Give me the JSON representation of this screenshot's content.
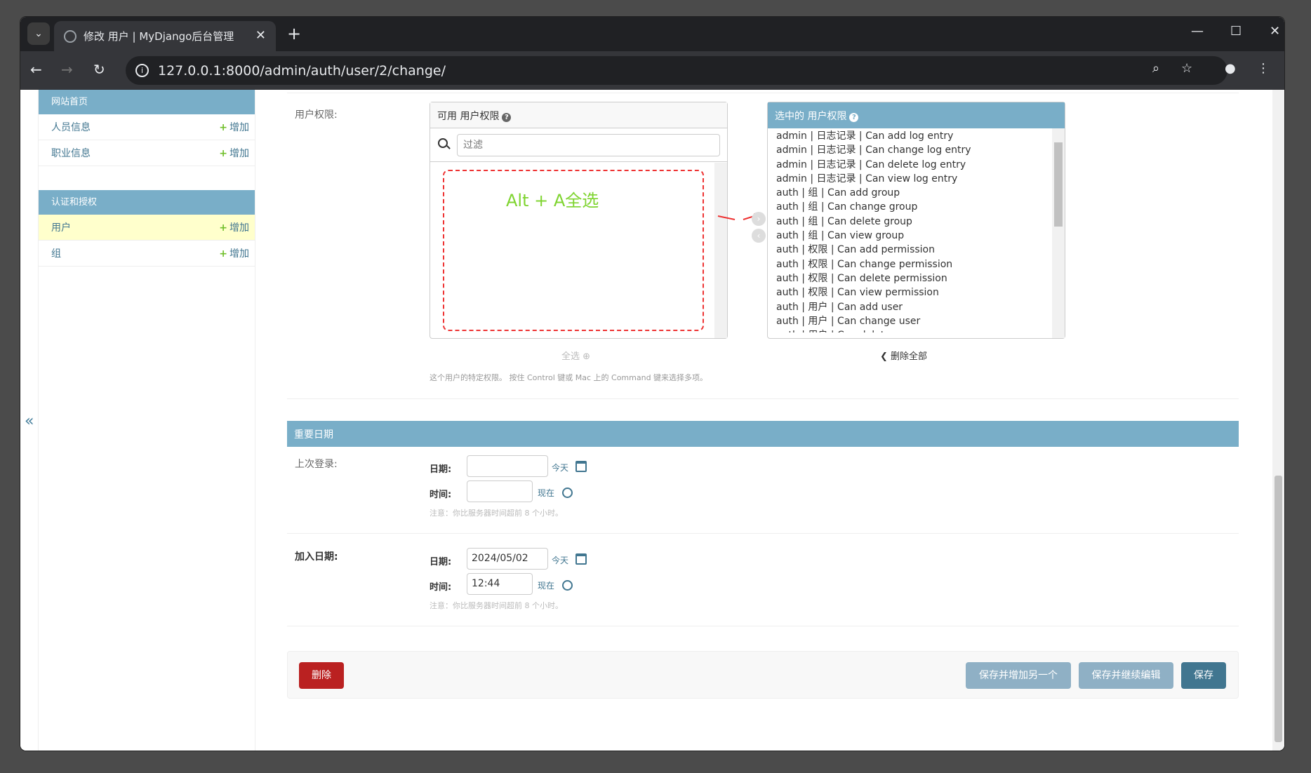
{
  "browser": {
    "tab_title": "修改 用户 | MyDjango后台管理",
    "url": "127.0.0.1:8000/admin/auth/user/2/change/"
  },
  "sidebar": {
    "modules": [
      {
        "title": "网站首页",
        "items": [
          {
            "label": "人员信息",
            "add": "增加"
          },
          {
            "label": "职业信息",
            "add": "增加"
          }
        ]
      },
      {
        "title": "认证和授权",
        "items": [
          {
            "label": "用户",
            "add": "增加"
          },
          {
            "label": "组",
            "add": "增加"
          }
        ]
      }
    ],
    "collapse": "«"
  },
  "permissions": {
    "label": "用户权限:",
    "available_title": "可用 用户权限",
    "filter_placeholder": "过滤",
    "annotation": "Alt + A全选",
    "choose_all": "全选",
    "chosen_title": "选中的 用户权限",
    "remove_all": "删除全部",
    "help_text": "这个用户的特定权限。 按住 Control 键或 Mac 上的 Command 键来选择多项。",
    "chosen_options": [
      "admin | 日志记录 | Can add log entry",
      "admin | 日志记录 | Can change log entry",
      "admin | 日志记录 | Can delete log entry",
      "admin | 日志记录 | Can view log entry",
      "auth | 组 | Can add group",
      "auth | 组 | Can change group",
      "auth | 组 | Can delete group",
      "auth | 组 | Can view group",
      "auth | 权限 | Can add permission",
      "auth | 权限 | Can change permission",
      "auth | 权限 | Can delete permission",
      "auth | 权限 | Can view permission",
      "auth | 用户 | Can add user",
      "auth | 用户 | Can change user",
      "auth | 用户 | Can delete user"
    ]
  },
  "dates": {
    "section_title": "重要日期",
    "last_login": {
      "label": "上次登录:",
      "date_label": "日期:",
      "date_value": "",
      "today": "今天",
      "time_label": "时间:",
      "time_value": "",
      "now": "现在",
      "note": "注意：你比服务器时间超前 8 个小时。"
    },
    "date_joined": {
      "label": "加入日期:",
      "date_label": "日期:",
      "date_value": "2024/05/02",
      "today": "今天",
      "time_label": "时间:",
      "time_value": "12:44",
      "now": "现在",
      "note": "注意：你比服务器时间超前 8 个小时。"
    }
  },
  "actions": {
    "delete": "删除",
    "save_add_another": "保存并增加另一个",
    "save_continue": "保存并继续编辑",
    "save": "保存"
  },
  "colors": {
    "header": "#79aec8",
    "delete": "#ba2121",
    "save": "#417690",
    "link": "#417690"
  }
}
